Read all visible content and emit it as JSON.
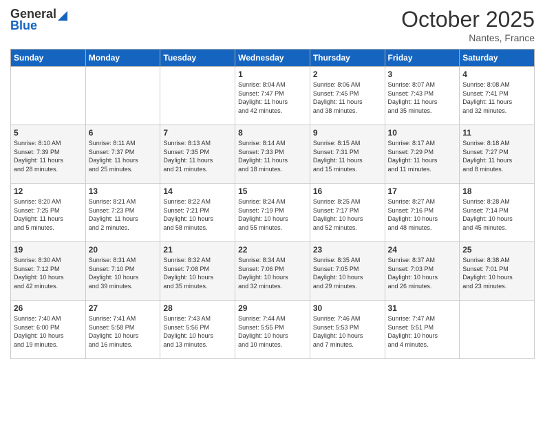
{
  "header": {
    "logo_line1": "General",
    "logo_line2": "Blue",
    "month": "October 2025",
    "location": "Nantes, France"
  },
  "days_of_week": [
    "Sunday",
    "Monday",
    "Tuesday",
    "Wednesday",
    "Thursday",
    "Friday",
    "Saturday"
  ],
  "weeks": [
    [
      {
        "day": "",
        "info": ""
      },
      {
        "day": "",
        "info": ""
      },
      {
        "day": "",
        "info": ""
      },
      {
        "day": "1",
        "info": "Sunrise: 8:04 AM\nSunset: 7:47 PM\nDaylight: 11 hours\nand 42 minutes."
      },
      {
        "day": "2",
        "info": "Sunrise: 8:06 AM\nSunset: 7:45 PM\nDaylight: 11 hours\nand 38 minutes."
      },
      {
        "day": "3",
        "info": "Sunrise: 8:07 AM\nSunset: 7:43 PM\nDaylight: 11 hours\nand 35 minutes."
      },
      {
        "day": "4",
        "info": "Sunrise: 8:08 AM\nSunset: 7:41 PM\nDaylight: 11 hours\nand 32 minutes."
      }
    ],
    [
      {
        "day": "5",
        "info": "Sunrise: 8:10 AM\nSunset: 7:39 PM\nDaylight: 11 hours\nand 28 minutes."
      },
      {
        "day": "6",
        "info": "Sunrise: 8:11 AM\nSunset: 7:37 PM\nDaylight: 11 hours\nand 25 minutes."
      },
      {
        "day": "7",
        "info": "Sunrise: 8:13 AM\nSunset: 7:35 PM\nDaylight: 11 hours\nand 21 minutes."
      },
      {
        "day": "8",
        "info": "Sunrise: 8:14 AM\nSunset: 7:33 PM\nDaylight: 11 hours\nand 18 minutes."
      },
      {
        "day": "9",
        "info": "Sunrise: 8:15 AM\nSunset: 7:31 PM\nDaylight: 11 hours\nand 15 minutes."
      },
      {
        "day": "10",
        "info": "Sunrise: 8:17 AM\nSunset: 7:29 PM\nDaylight: 11 hours\nand 11 minutes."
      },
      {
        "day": "11",
        "info": "Sunrise: 8:18 AM\nSunset: 7:27 PM\nDaylight: 11 hours\nand 8 minutes."
      }
    ],
    [
      {
        "day": "12",
        "info": "Sunrise: 8:20 AM\nSunset: 7:25 PM\nDaylight: 11 hours\nand 5 minutes."
      },
      {
        "day": "13",
        "info": "Sunrise: 8:21 AM\nSunset: 7:23 PM\nDaylight: 11 hours\nand 2 minutes."
      },
      {
        "day": "14",
        "info": "Sunrise: 8:22 AM\nSunset: 7:21 PM\nDaylight: 10 hours\nand 58 minutes."
      },
      {
        "day": "15",
        "info": "Sunrise: 8:24 AM\nSunset: 7:19 PM\nDaylight: 10 hours\nand 55 minutes."
      },
      {
        "day": "16",
        "info": "Sunrise: 8:25 AM\nSunset: 7:17 PM\nDaylight: 10 hours\nand 52 minutes."
      },
      {
        "day": "17",
        "info": "Sunrise: 8:27 AM\nSunset: 7:16 PM\nDaylight: 10 hours\nand 48 minutes."
      },
      {
        "day": "18",
        "info": "Sunrise: 8:28 AM\nSunset: 7:14 PM\nDaylight: 10 hours\nand 45 minutes."
      }
    ],
    [
      {
        "day": "19",
        "info": "Sunrise: 8:30 AM\nSunset: 7:12 PM\nDaylight: 10 hours\nand 42 minutes."
      },
      {
        "day": "20",
        "info": "Sunrise: 8:31 AM\nSunset: 7:10 PM\nDaylight: 10 hours\nand 39 minutes."
      },
      {
        "day": "21",
        "info": "Sunrise: 8:32 AM\nSunset: 7:08 PM\nDaylight: 10 hours\nand 35 minutes."
      },
      {
        "day": "22",
        "info": "Sunrise: 8:34 AM\nSunset: 7:06 PM\nDaylight: 10 hours\nand 32 minutes."
      },
      {
        "day": "23",
        "info": "Sunrise: 8:35 AM\nSunset: 7:05 PM\nDaylight: 10 hours\nand 29 minutes."
      },
      {
        "day": "24",
        "info": "Sunrise: 8:37 AM\nSunset: 7:03 PM\nDaylight: 10 hours\nand 26 minutes."
      },
      {
        "day": "25",
        "info": "Sunrise: 8:38 AM\nSunset: 7:01 PM\nDaylight: 10 hours\nand 23 minutes."
      }
    ],
    [
      {
        "day": "26",
        "info": "Sunrise: 7:40 AM\nSunset: 6:00 PM\nDaylight: 10 hours\nand 19 minutes."
      },
      {
        "day": "27",
        "info": "Sunrise: 7:41 AM\nSunset: 5:58 PM\nDaylight: 10 hours\nand 16 minutes."
      },
      {
        "day": "28",
        "info": "Sunrise: 7:43 AM\nSunset: 5:56 PM\nDaylight: 10 hours\nand 13 minutes."
      },
      {
        "day": "29",
        "info": "Sunrise: 7:44 AM\nSunset: 5:55 PM\nDaylight: 10 hours\nand 10 minutes."
      },
      {
        "day": "30",
        "info": "Sunrise: 7:46 AM\nSunset: 5:53 PM\nDaylight: 10 hours\nand 7 minutes."
      },
      {
        "day": "31",
        "info": "Sunrise: 7:47 AM\nSunset: 5:51 PM\nDaylight: 10 hours\nand 4 minutes."
      },
      {
        "day": "",
        "info": ""
      }
    ]
  ]
}
